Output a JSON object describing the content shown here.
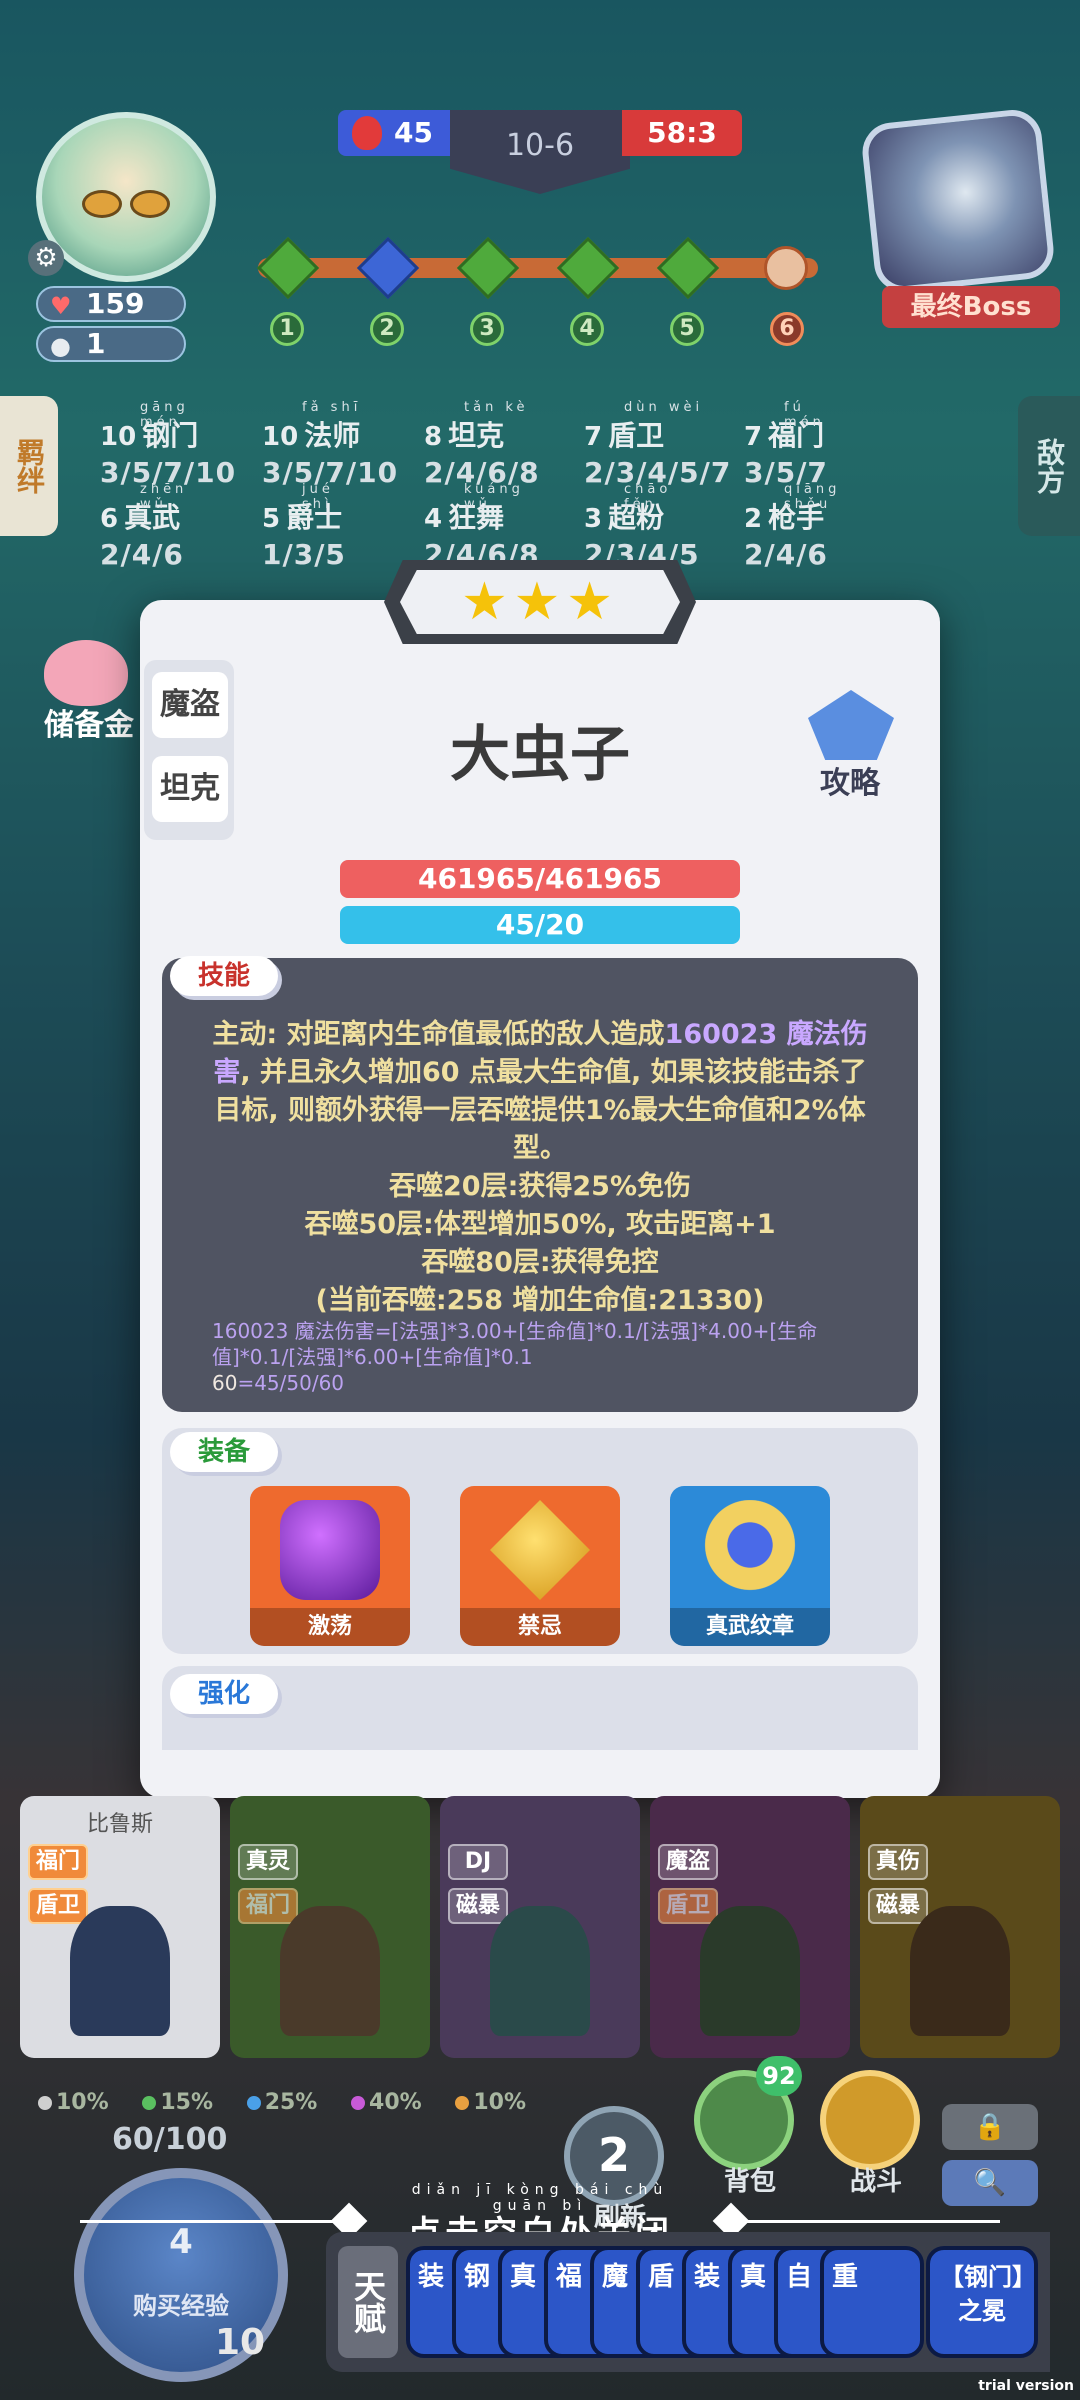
{
  "hud": {
    "player_hp": "159",
    "player_coins": "1",
    "score_left": "45",
    "round": "10-6",
    "score_right": "58:3",
    "boss_label": "最终Boss",
    "stages": [
      "1",
      "2",
      "3",
      "4",
      "5",
      "6"
    ]
  },
  "side_tabs": {
    "left": "羁绊",
    "right": "敌方"
  },
  "synergies": [
    {
      "count": "10",
      "pinyin": "gāng mén",
      "name": "钢门",
      "tiers": "3/5/7/10"
    },
    {
      "count": "10",
      "pinyin": "fǎ shī",
      "name": "法师",
      "tiers": "3/5/7/10"
    },
    {
      "count": "8",
      "pinyin": "tǎn kè",
      "name": "坦克",
      "tiers": "2/4/6/8"
    },
    {
      "count": "7",
      "pinyin": "dùn wèi",
      "name": "盾卫",
      "tiers": "2/3/4/5/7"
    },
    {
      "count": "7",
      "pinyin": "fú mén",
      "name": "福门",
      "tiers": "3/5/7"
    },
    {
      "count": "6",
      "pinyin": "zhēn wǔ",
      "name": "真武",
      "tiers": "2/4/6"
    },
    {
      "count": "5",
      "pinyin": "jué shì",
      "name": "爵士",
      "tiers": "1/3/5"
    },
    {
      "count": "4",
      "pinyin": "kuáng wǔ",
      "name": "狂舞",
      "tiers": "2/4/6/8"
    },
    {
      "count": "3",
      "pinyin": "chāo fěn",
      "name": "超粉",
      "tiers": "2/3/4/5"
    },
    {
      "count": "2",
      "pinyin": "qiāng shǒu",
      "name": "枪手",
      "tiers": "2/4/6"
    }
  ],
  "savings_label": "储备金",
  "modal": {
    "stars": "★★★",
    "class_tabs": [
      "魔盗",
      "坦克"
    ],
    "unit_name": "大虫子",
    "guide_label": "攻略",
    "hp": "461965/461965",
    "mana": "45/20",
    "skill_tag": "技能",
    "skill_lines": {
      "l1a": "主动: 对距离内生命值最低的敌人造成",
      "l1b": "160023 魔法伤害",
      "l1c": ", 并且永久增加60 点最大生命值, 如果该技能击杀了目标, 则额外获得一层吞噬提供1%最大生命值和2%体型。",
      "l2": "吞噬20层:获得25%免伤",
      "l3": "吞噬50层:体型增加50%, 攻击距离+1",
      "l4": "吞噬80层:获得免控",
      "l5": "(当前吞噬:258 增加生命值:21330)"
    },
    "formula_a": "160023 魔法伤害=[法强]*3.00+[生命值]*0.1/[法强]*4.00+[生命值]*0.1/[法强]*6.00+[生命值]*0.1",
    "formula_b": "60",
    "formula_c": "=45/50/60",
    "equip_tag": "装备",
    "equipment": [
      "激荡",
      "禁忌",
      "真武纹章"
    ],
    "enhance_tag": "强化"
  },
  "bench": [
    {
      "name": "比鲁斯",
      "traits": [
        "福门",
        "盾卫"
      ]
    },
    {
      "name": "",
      "traits": [
        "真灵",
        "福门"
      ]
    },
    {
      "name": "",
      "traits": [
        "DJ",
        "磁暴"
      ]
    },
    {
      "name": "",
      "traits": [
        "魔盗",
        "盾卫"
      ]
    },
    {
      "name": "",
      "traits": [
        "真伤",
        "磁暴"
      ]
    }
  ],
  "odds": [
    "10%",
    "15%",
    "25%",
    "40%",
    "10%"
  ],
  "odds_colors": [
    "#cfcfcf",
    "#5ac060",
    "#4aa0e8",
    "#c85ad8",
    "#e8a040"
  ],
  "xp": "60/100",
  "buy_xp": {
    "cost": "4",
    "label": "购买经验"
  },
  "level": "10",
  "refresh": {
    "count": "2",
    "label": "刷新"
  },
  "bag": {
    "label": "背包",
    "badge": "92"
  },
  "fight_label": "战斗",
  "close_hint": {
    "pinyin": "diǎn jī kòng bái chù guān bì",
    "text": "点击空白处关闭"
  },
  "talent": {
    "label": "天赋",
    "cards": [
      "装",
      "钢",
      "真",
      "福",
      "魔",
      "盾",
      "装",
      "真",
      "自",
      "重"
    ],
    "last_card": "【钢门】之冕"
  },
  "trial": "trial version"
}
